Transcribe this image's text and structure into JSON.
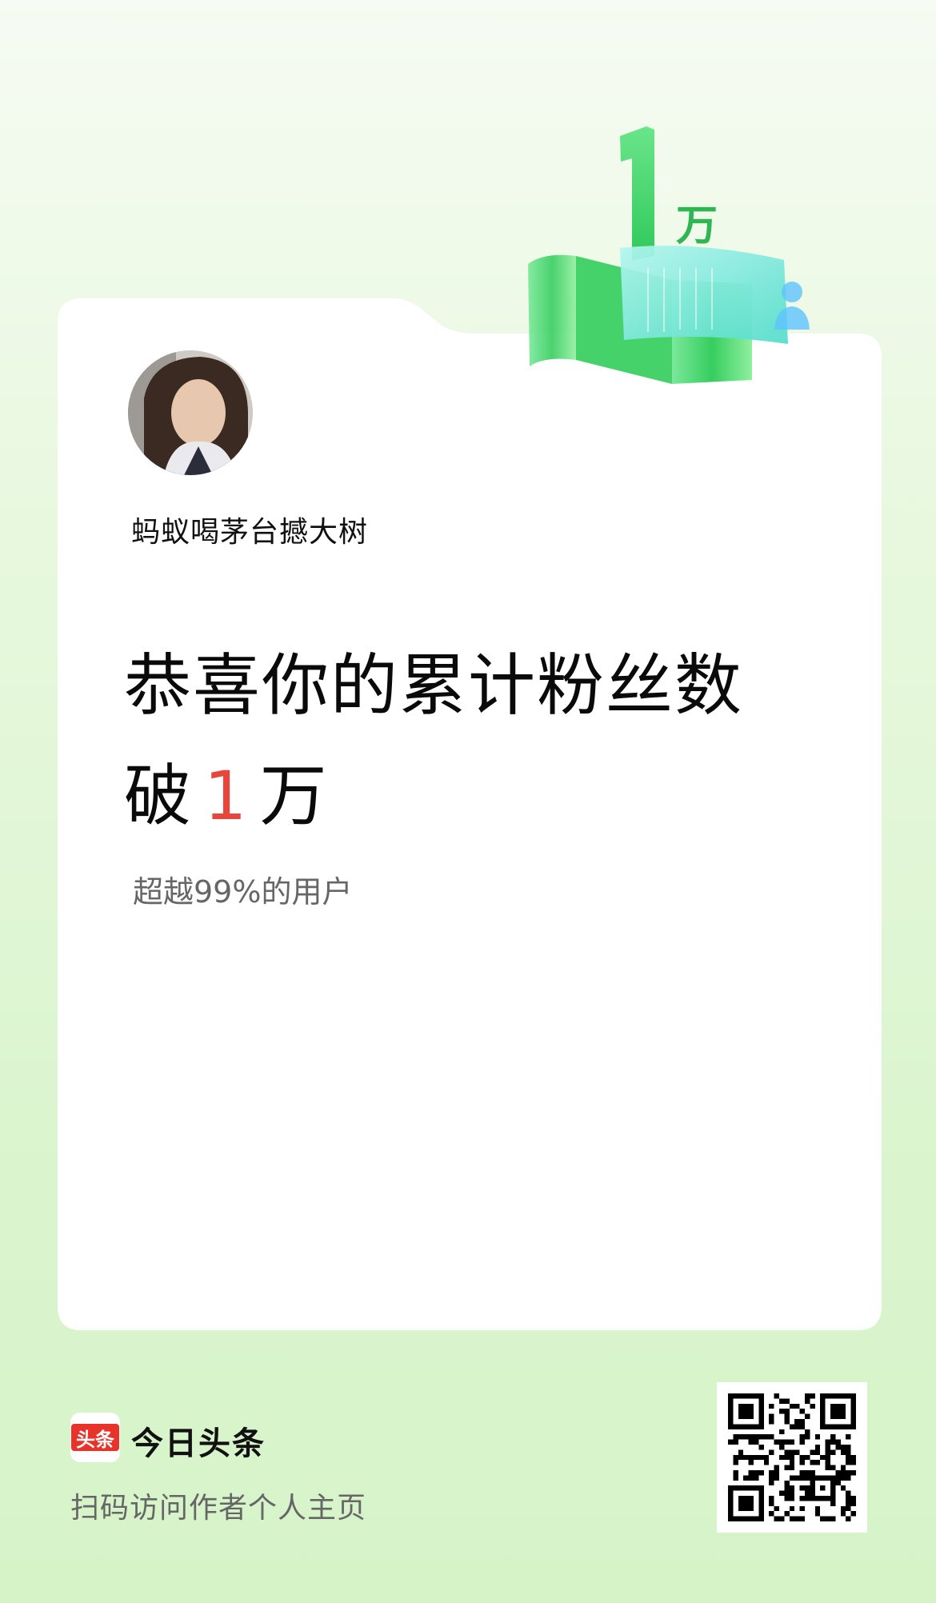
{
  "badge": {
    "number": "1",
    "unit": "万"
  },
  "profile": {
    "username": "蚂蚁喝茅台撼大树"
  },
  "headline": {
    "line1": "恭喜你的累计粉丝数",
    "line2_prefix": "破",
    "line2_number": "1",
    "line2_suffix": "万"
  },
  "subline": "超越99%的用户",
  "footer": {
    "logo_text": "头条",
    "brand_name": "今日头条",
    "scan_text": "扫码访问作者个人主页"
  },
  "colors": {
    "accent_red": "#e8453c",
    "brand_red": "#e8332b",
    "badge_green": "#3fd46a",
    "badge_cyan": "#8ff0e6"
  },
  "icons": [
    "user-icon",
    "qr-code"
  ]
}
